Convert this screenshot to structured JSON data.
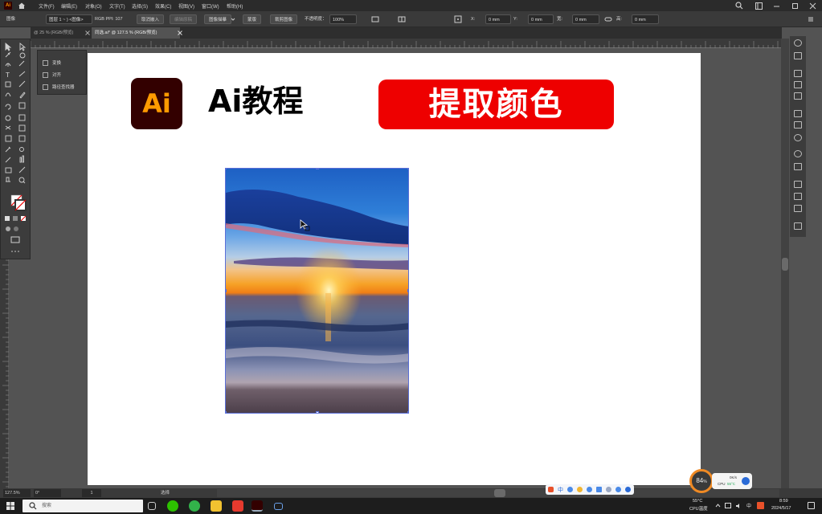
{
  "menubar": {
    "items": [
      "文件(F)",
      "编辑(E)",
      "对象(O)",
      "文字(T)",
      "选择(S)",
      "效果(C)",
      "视图(V)",
      "窗口(W)",
      "帮助(H)"
    ]
  },
  "controlbar": {
    "mode": "图像",
    "layer_info": "图层 1 ~ ) <图像>",
    "color_info": "RGB  PPI: 107",
    "cancel_embed": "取消嵌入",
    "edit_original": "编辑原稿",
    "image_trace": "图像描摹",
    "mask": "蒙版",
    "crop_image": "裁剪图像",
    "opacity_label": "不透明度：",
    "opacity_value": "100%",
    "x_label": "X:",
    "x_value": "0 mm",
    "y_label": "Y:",
    "y_value": "0 mm",
    "w_label": "宽:",
    "w_value": "0 mm",
    "h_label": "高:",
    "h_value": "0 mm"
  },
  "tabs": [
    {
      "label": "@ 25 % (RGB/预览)"
    },
    {
      "label": "同选.ai* @ 127.5 % (RGB/预览)"
    }
  ],
  "floatpanel": {
    "items": [
      "变换",
      "对齐",
      "路径查找器"
    ]
  },
  "artboard": {
    "logo_text": "Ai",
    "title": "Ai教程",
    "badge": "提取颜色"
  },
  "statusbar": {
    "zoom": "127.5%",
    "rotation": "0°",
    "artboard_num": "1",
    "tool": "选择"
  },
  "taskbar": {
    "search_placeholder": "搜索",
    "temperature": "55°C",
    "temperature_label": "CPU温度",
    "ime": "中",
    "time": "8:59",
    "date": "2024/5/17"
  },
  "cpuwidget": {
    "percent": "84",
    "percent_unit": "%",
    "speed": "0K/s",
    "cpu_label": "CPU",
    "cpu_temp": "55°C"
  },
  "colors": {
    "ai_logo_bg": "#330000",
    "ai_logo_fg": "#ff9a00",
    "badge_red": "#ee0000",
    "selection_blue": "#5a6fd8"
  }
}
